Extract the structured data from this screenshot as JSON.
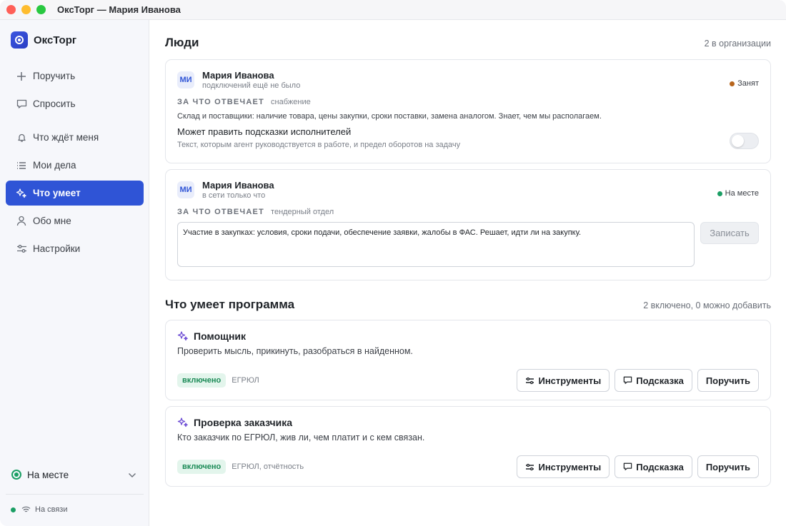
{
  "window": {
    "title": "ОксТорг — Мария Иванова"
  },
  "sidebar": {
    "brand": "ОксТорг",
    "items": [
      {
        "label": "Поручить",
        "icon": "plus-icon"
      },
      {
        "label": "Спросить",
        "icon": "chat-icon"
      },
      {
        "label": "Что ждёт меня",
        "icon": "bell-icon"
      },
      {
        "label": "Мои дела",
        "icon": "list-icon"
      },
      {
        "label": "Что умеет",
        "icon": "sparkle-icon",
        "active": true
      },
      {
        "label": "Обо мне",
        "icon": "user-icon"
      },
      {
        "label": "Настройки",
        "icon": "sliders-icon"
      }
    ],
    "status": "На месте",
    "connection": "На связи"
  },
  "people": {
    "title": "Люди",
    "meta": "2 в организации",
    "cards": [
      {
        "initials": "МИ",
        "name": "Мария Иванова",
        "sub": "подключений ещё не было",
        "badge": "Занят",
        "badge_color": "#b7651c",
        "resp_label": "ЗА ЧТО ОТВЕЧАЕТ",
        "resp_value": "снабжение",
        "resp_text": "Склад и поставщики: наличие товара, цены закупки, сроки поставки, замена аналогом. Знает, чем мы располагаем.",
        "perm_title": "Может править подсказки исполнителей",
        "perm_sub": "Текст, которым агент руководствуется в работе, и предел оборотов на задачу",
        "perm_enabled": false
      },
      {
        "initials": "МИ",
        "name": "Мария Иванова",
        "sub": "в сети только что",
        "badge": "На месте",
        "badge_color": "#1a9e64",
        "resp_label": "ЗА ЧТО ОТВЕЧАЕТ",
        "resp_value": "тендерный отдел",
        "textarea_value": "Участие в закупках: условия, сроки подачи, обеспечение заявки, жалобы в ФАС. Решает, идти ли на закупку.",
        "save_label": "Записать"
      }
    ]
  },
  "capabilities": {
    "title": "Что умеет программа",
    "meta": "2 включено, 0 можно добавить",
    "items": [
      {
        "title": "Помощник",
        "desc": "Проверить мысль, прикинуть, разобраться в найденном.",
        "state": "включено",
        "tags": "ЕГРЮЛ",
        "btn_tools": "Инструменты",
        "btn_hint": "Подсказка",
        "btn_assign": "Поручить"
      },
      {
        "title": "Проверка заказчика",
        "desc": "Кто заказчик по ЕГРЮЛ, жив ли, чем платит и с кем связан.",
        "state": "включено",
        "tags": "ЕГРЮЛ, отчётность",
        "btn_tools": "Инструменты",
        "btn_hint": "Подсказка",
        "btn_assign": "Поручить"
      }
    ]
  }
}
